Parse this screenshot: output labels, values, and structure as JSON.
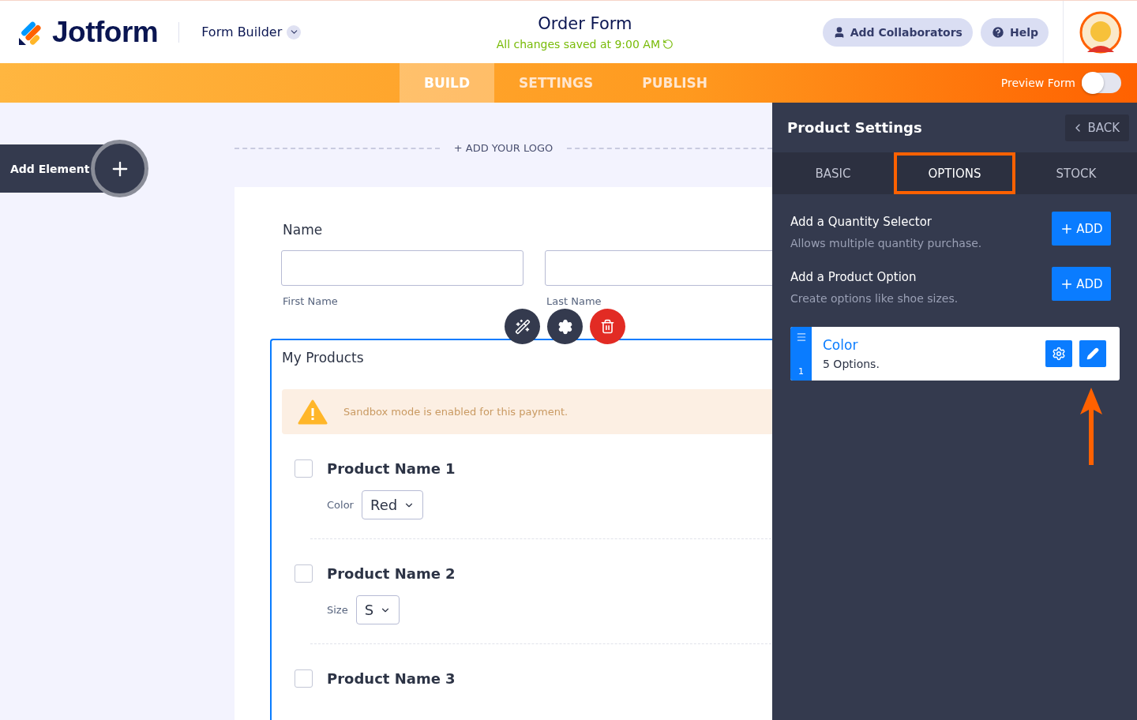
{
  "header": {
    "brand": "Jotform",
    "app_menu": "Form Builder",
    "title": "Order Form",
    "save_status": "All changes saved at 9:00 AM",
    "buttons": [
      {
        "label": "Add Collaborators",
        "kind": "collab"
      },
      {
        "label": "Help",
        "kind": "help"
      }
    ]
  },
  "nav": {
    "tabs": [
      {
        "label": "BUILD",
        "selected": true
      },
      {
        "label": "SETTINGS",
        "selected": false
      },
      {
        "label": "PUBLISH",
        "selected": false
      }
    ],
    "preview": {
      "label": "Preview Form",
      "on": false
    }
  },
  "canvas": {
    "add_element": "Add Element",
    "add_logo": "+ ADD YOUR LOGO",
    "name_field": {
      "label": "Name",
      "sublabels": [
        "First Name",
        "Last Name"
      ]
    },
    "products": {
      "title": "My Products",
      "notice": "Sandbox mode is enabled for this payment.",
      "items": [
        {
          "name": "Product Name 1",
          "checked": false,
          "option_label": "Color",
          "option_value": "Red"
        },
        {
          "name": "Product Name 2",
          "checked": false,
          "option_label": "Size",
          "option_value": "S"
        },
        {
          "name": "Product Name 3",
          "checked": false
        }
      ]
    }
  },
  "panel": {
    "title": "Product Settings",
    "back": "BACK",
    "tabs": [
      {
        "label": "BASIC",
        "selected": false
      },
      {
        "label": "OPTIONS",
        "selected": true
      },
      {
        "label": "STOCK",
        "selected": false
      }
    ],
    "sections": [
      {
        "title": "Add a Quantity Selector",
        "description": "Allows multiple quantity purchase.",
        "button": "ADD"
      },
      {
        "title": "Add a Product Option",
        "description": "Create options like shoe sizes.",
        "button": "ADD"
      }
    ],
    "options": [
      {
        "index": "1",
        "name": "Color",
        "count": "5 Options."
      }
    ]
  }
}
